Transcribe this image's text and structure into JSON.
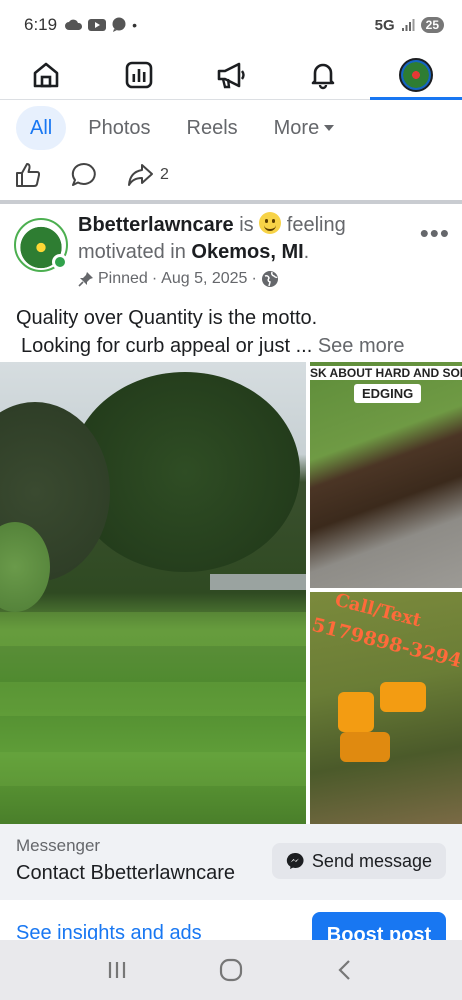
{
  "status_bar": {
    "time": "6:19",
    "network": "5G",
    "battery": "25"
  },
  "nav": {
    "items": [
      {
        "name": "home"
      },
      {
        "name": "dashboard"
      },
      {
        "name": "ads"
      },
      {
        "name": "notifications"
      },
      {
        "name": "profile",
        "active": true
      }
    ]
  },
  "filters": {
    "all": "All",
    "photos": "Photos",
    "reels": "Reels",
    "more": "More"
  },
  "actions": {
    "share_count": "2"
  },
  "post": {
    "author": "Bbetterlawncare",
    "is_text": "is",
    "feeling_text": "feeling",
    "motivated_text": "motivated in",
    "location": "Okemos, MI",
    "period": ".",
    "pinned": "Pinned",
    "date": "Aug 5, 2025",
    "body_line1": "Quality over Quantity is the motto.",
    "body_line2": "Looking for curb appeal or just ...",
    "see_more": "See more",
    "image_top_right_header": "SK ABOUT HARD AND SOFT",
    "image_top_right_sub": "EDGING",
    "image_bottom_right_call": "Call/Text",
    "image_bottom_right_phone": "5179898-3294"
  },
  "cta": {
    "label": "Messenger",
    "name": "Contact Bbetterlawncare",
    "button": "Send message"
  },
  "bottom": {
    "insights": "See insights and ads",
    "boost": "Boost post"
  },
  "colors": {
    "accent": "#1877f2",
    "chip_active_bg": "#e7f0fd",
    "online": "#31a24c"
  }
}
